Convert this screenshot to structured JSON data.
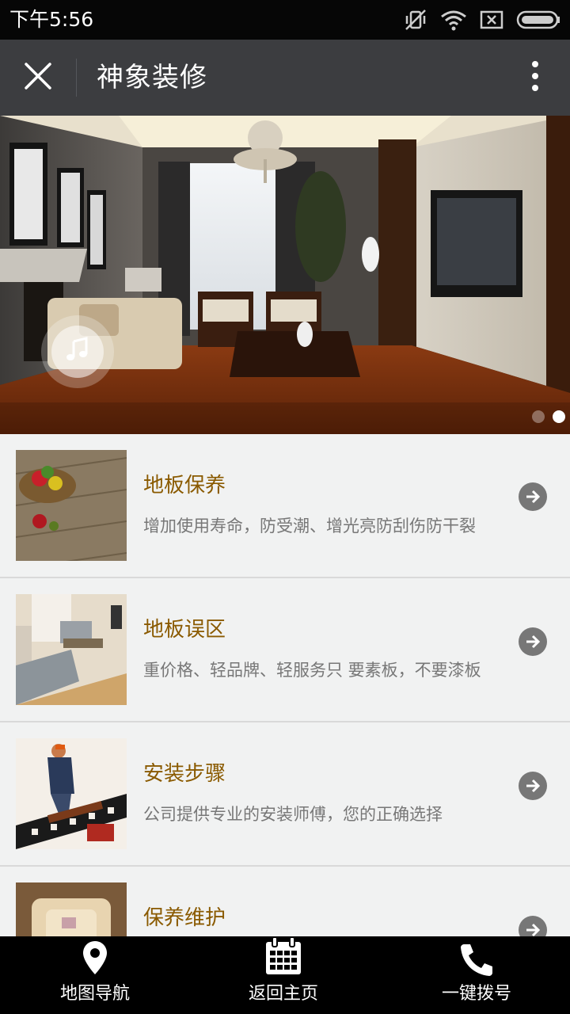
{
  "status_bar": {
    "time": "下午5:56",
    "icons": [
      "mute-vibrate-icon",
      "wifi-icon",
      "sim-x-icon",
      "battery-icon"
    ]
  },
  "title_bar": {
    "title": "神象装修",
    "close_icon": "close-icon",
    "more_icon": "more-vertical-icon"
  },
  "banner": {
    "image": "living-room-photo",
    "music_icon": "music-note-icon",
    "slide_count": 2,
    "active_slide": 2
  },
  "items": [
    {
      "title": "地板保养",
      "desc": "增加使用寿命，防受潮、增光亮防刮伤防干裂",
      "thumb": "wood-floor-fruit-photo"
    },
    {
      "title": "地板误区",
      "desc": "重价格、轻品牌、轻服务只 要素板，不要漆板",
      "thumb": "living-room-sofa-photo"
    },
    {
      "title": "安装步骤",
      "desc": "公司提供专业的安装师傅，您的正确选择",
      "thumb": "floor-installer-photo"
    },
    {
      "title": "保养维护",
      "desc": "",
      "thumb": "armchair-photo"
    }
  ],
  "bottom_nav": [
    {
      "label": "地图导航",
      "icon": "map-pin-icon"
    },
    {
      "label": "返回主页",
      "icon": "calendar-icon"
    },
    {
      "label": "一键拨号",
      "icon": "phone-icon"
    }
  ],
  "colors": {
    "status_bg": "#060606",
    "title_bg": "#3c3d40",
    "item_title": "#8a5a00",
    "item_desc": "#777777",
    "bottom_nav_bg": "#000000"
  }
}
